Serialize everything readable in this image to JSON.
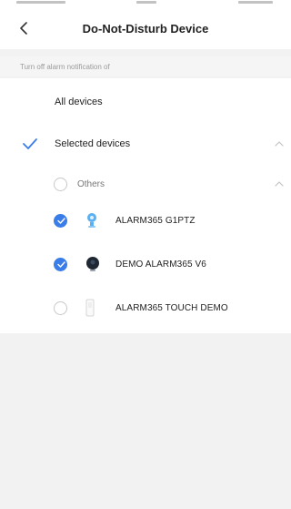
{
  "header": {
    "title": "Do-Not-Disturb Device",
    "back_icon": "chevron-left-icon"
  },
  "section": {
    "caption": "Turn off alarm notification of"
  },
  "options": {
    "all_devices": {
      "label": "All devices",
      "selected": false
    },
    "selected_devices": {
      "label": "Selected devices",
      "selected": true,
      "icon": "check-icon",
      "expanded": true
    }
  },
  "groups": [
    {
      "label": "Others",
      "checked": false,
      "expanded": true,
      "devices": [
        {
          "name": "ALARM365 G1PTZ",
          "checked": true,
          "icon": "bulb-camera-icon"
        },
        {
          "name": "DEMO ALARM365 V6",
          "checked": true,
          "icon": "dome-camera-icon"
        },
        {
          "name": "ALARM365 TOUCH DEMO",
          "checked": false,
          "icon": "touch-panel-icon"
        }
      ]
    }
  ],
  "colors": {
    "accent": "#3a7de8",
    "background": "#f2f2f2",
    "panel": "#ffffff",
    "caption_text": "#9a9a9a"
  }
}
